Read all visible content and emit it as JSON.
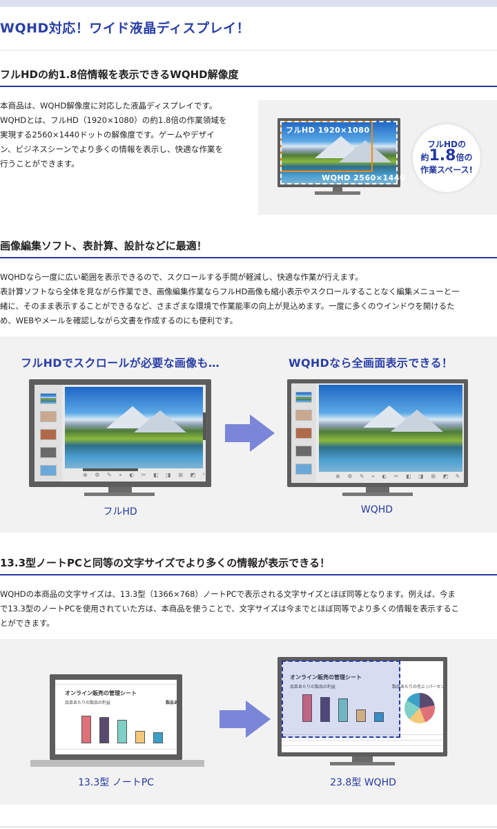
{
  "page": {
    "title": "WQHD対応！ワイド液晶ディスプレイ！"
  },
  "section1": {
    "heading": "フルHDの約1.8倍情報を表示できるWQHD解像度",
    "lines": [
      "本商品は、WQHD解像度に対応した液晶ディスプレイです。",
      "WQHDとは、フルHD（1920×1080）の約1.8倍の作業領域を",
      "実現する2560×1440ドットの解像度です。ゲームやデザイ",
      "ン、ビジネスシーンでより多くの情報を表示し、快適な作業を",
      "行うことができます。"
    ],
    "image": {
      "fhd_label": "フルHD 1920×1080",
      "wqhd_label": "WQHD 2560×1440",
      "badge_line1": "フルHDの",
      "badge_prefix": "約",
      "badge_value": "1.8",
      "badge_suffix": "倍の",
      "badge_line3": "作業スペース!",
      "accent_orange": "#f08a12",
      "accent_blue": "#2337a0"
    }
  },
  "section2": {
    "heading": "画像編集ソフト、表計算、設計などに最適！",
    "lines": [
      "WQHDなら一度に広い範囲を表示できるので、スクロールする手間が軽減し、快適な作業が行えます。",
      "表計算ソフトなら全体を見ながら作業でき、画像編集作業ならフルHD画像も縮小表示やスクロールすることなく編集メニューと一",
      "緒に、そのまま表示することができるなど、さまざまな環境で作業能率の向上が見込めます。一度に多くのウインドウを開けるた",
      "め、WEBやメールを確認しながら文書を作成するのにも便利です。"
    ],
    "compare": {
      "left_heading": "フルHDでスクロールが必要な画像も…",
      "right_heading": "WQHDなら全画面表示できる！",
      "left_caption": "フルHD",
      "right_caption": "WQHD",
      "toolbar_icons": "⊕ ⚙ ✎ ⌖ ◐ ✂ ◧ ◨ ⊞ ◩ ✎ ⊙ ◪ ⚙",
      "arrow_color": "#7b86d8"
    }
  },
  "section3": {
    "heading": "13.3型ノートPCと同等の文字サイズでより多くの情報が表示できる！",
    "lines": [
      "WQHDの本商品の文字サイズは、13.3型（1366×768）ノートPCで表示される文字サイズとほぼ同等となります。例えば、今ま",
      "で13.3型のノートPCを使用されていた方は、本商品を使うことで、文字サイズは今までとほぼ同等でより多くの情報を表示するこ",
      "とができます。"
    ],
    "compare": {
      "sheet_title": "オンライン販売の管理シート",
      "sheet_subtitle": "品目あたりの製品の利益",
      "sheet_side_title_short": "製品あ",
      "sheet_side_title": "製品あたりの売上 (パーセント",
      "left_caption": "13.3型 ノートPC",
      "right_caption": "23.8型 WQHD",
      "bar_colors": [
        "#e07078",
        "#5a4a70",
        "#7fd0c6",
        "#f4c878",
        "#3aa0c8"
      ],
      "pie_colors": [
        "#5a4a70",
        "#e07078",
        "#f4c878",
        "#7fd0c6",
        "#3aa0c8"
      ]
    }
  }
}
